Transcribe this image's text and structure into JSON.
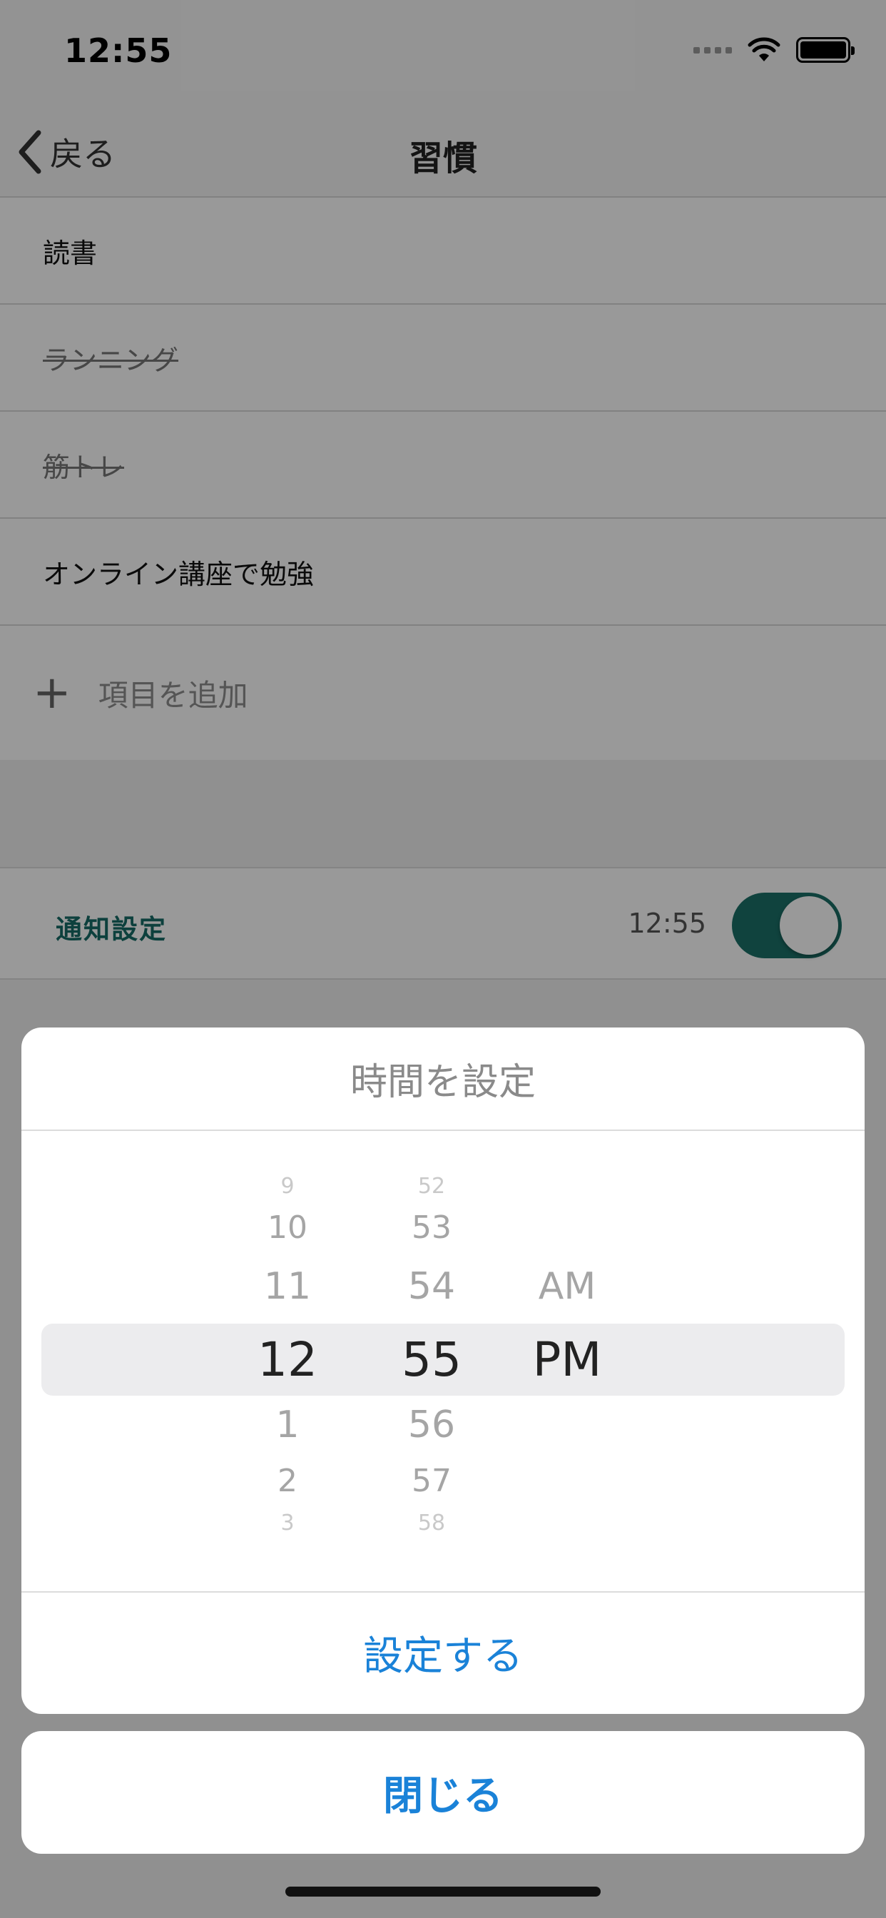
{
  "status_bar": {
    "time": "12:55"
  },
  "nav": {
    "back_label": "戻る",
    "title": "習慣"
  },
  "habits": [
    {
      "label": "読書",
      "done": false
    },
    {
      "label": "ランニング",
      "done": true
    },
    {
      "label": "筋トレ",
      "done": true
    },
    {
      "label": "オンライン講座で勉強",
      "done": false
    }
  ],
  "add_item": {
    "label": "項目を追加"
  },
  "notification": {
    "label": "通知設定",
    "time": "12:55",
    "enabled": true,
    "accent_color": "#1b7068"
  },
  "time_sheet": {
    "title": "時間を設定",
    "picker": {
      "hours": {
        "above": [
          "9",
          "10",
          "11"
        ],
        "selected": "12",
        "below": [
          "1",
          "2",
          "3"
        ]
      },
      "minutes": {
        "above": [
          "52",
          "53",
          "54"
        ],
        "selected": "55",
        "below": [
          "56",
          "57",
          "58"
        ]
      },
      "ampm": {
        "above": [
          "AM"
        ],
        "selected": "PM"
      }
    },
    "confirm_label": "設定する",
    "link_color": "#1a82d8"
  },
  "close_label": "閉じる"
}
